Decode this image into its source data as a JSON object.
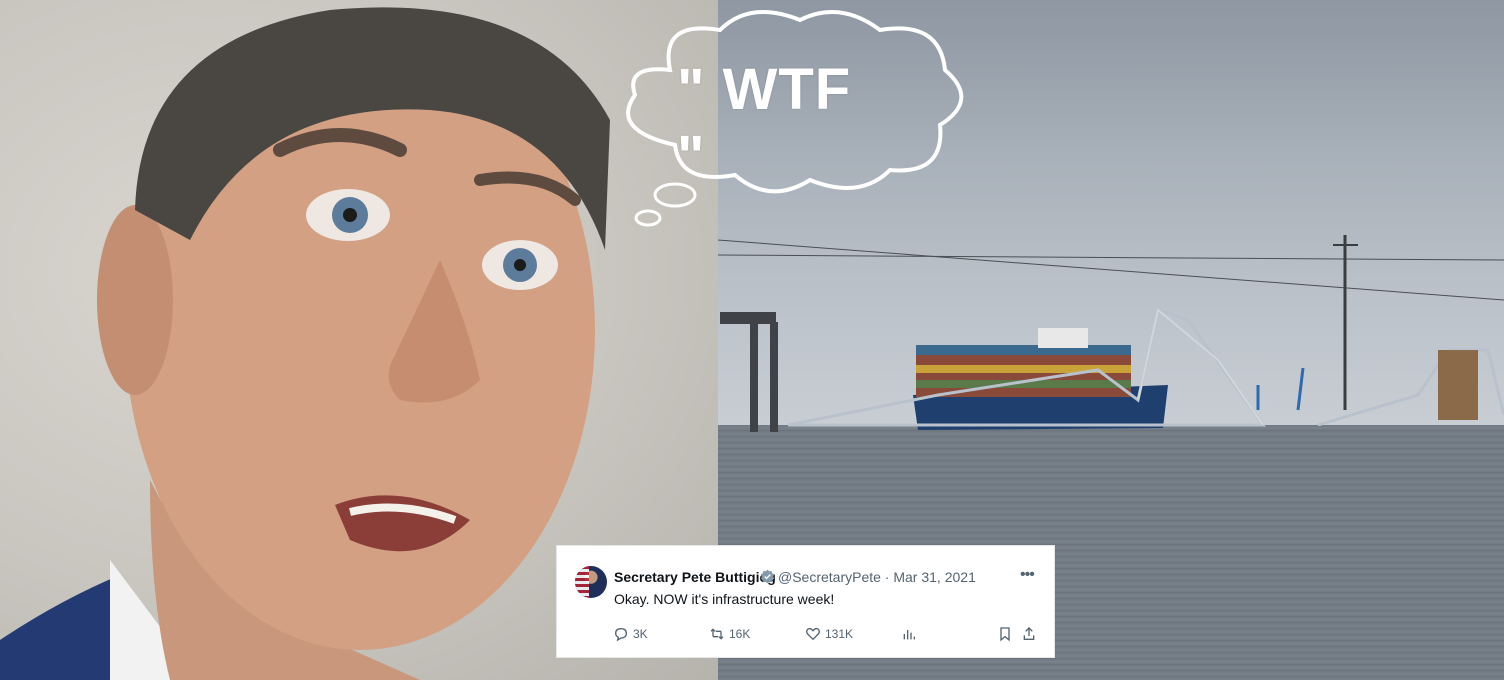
{
  "thought_bubble": {
    "text": "\" WTF \""
  },
  "tweet": {
    "display_name": "Secretary Pete Buttigieg",
    "handle_date": "@SecretaryPete · Mar 31, 2021",
    "text": "Okay. NOW it's infrastructure week!",
    "replies": "3K",
    "retweets": "16K",
    "likes": "131K",
    "more_icon": "ellipsis-icon",
    "verified_color": "#829aab"
  },
  "colors": {
    "tweet_bg": "#ffffff",
    "text": "#0f1419",
    "muted": "#536471"
  }
}
